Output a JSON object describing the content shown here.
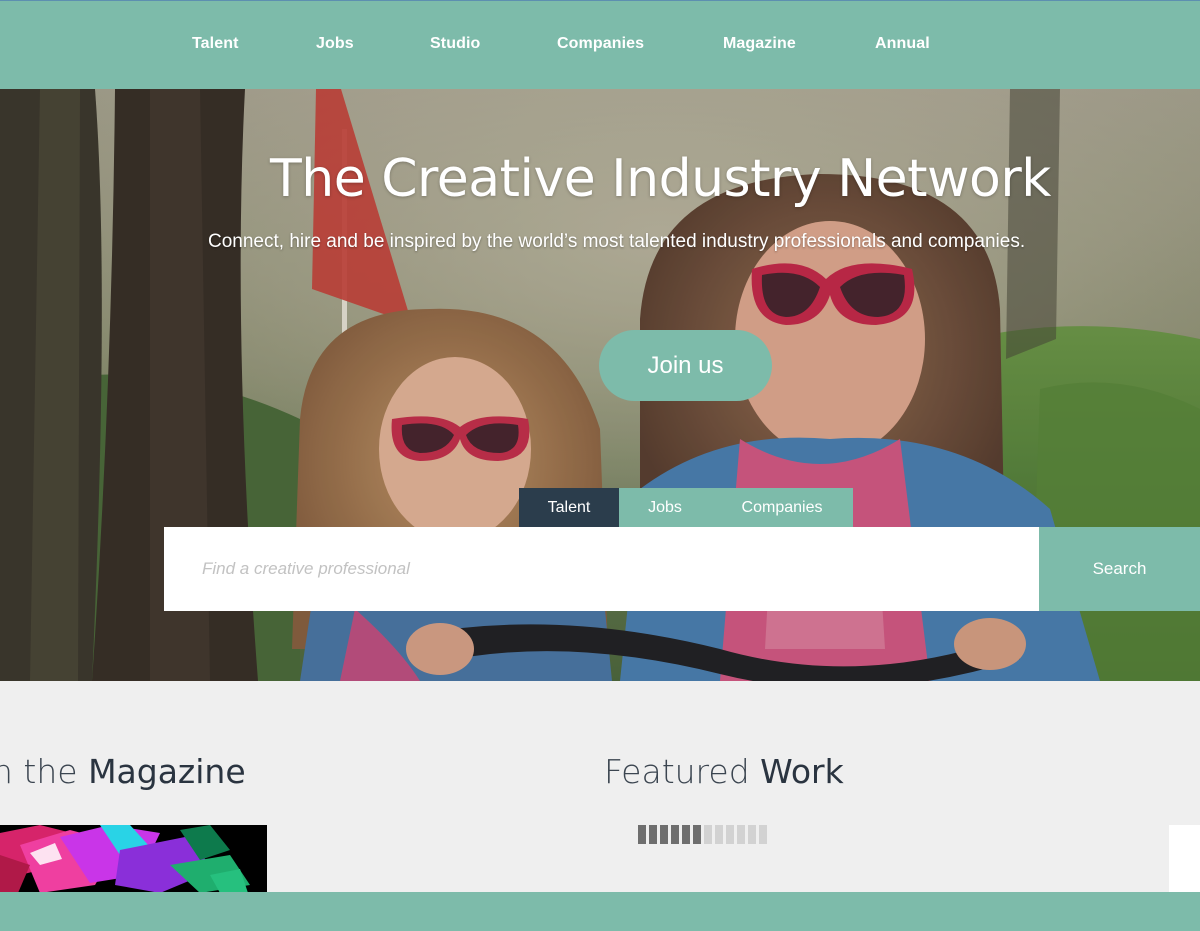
{
  "nav": {
    "items": [
      {
        "label": "Talent"
      },
      {
        "label": "Jobs"
      },
      {
        "label": "Studio"
      },
      {
        "label": "Companies"
      },
      {
        "label": "Magazine"
      },
      {
        "label": "Annual"
      }
    ]
  },
  "hero": {
    "title": "The Creative Industry Network",
    "subtitle": "Connect, hire and be inspired by the world’s most talented industry professionals and companies.",
    "join_label": "Join us",
    "image_subject": "two-girls-heart-sunglasses-bikes"
  },
  "search": {
    "tabs": [
      {
        "label": "Talent",
        "active": true
      },
      {
        "label": "Jobs",
        "active": false
      },
      {
        "label": "Companies",
        "active": false
      }
    ],
    "placeholder": "Find a creative professional",
    "button_label": "Search"
  },
  "magazine": {
    "heading_prefix": "n the ",
    "heading_strong": "Magazine"
  },
  "featured": {
    "heading_prefix": "Featured ",
    "heading_strong": "Work",
    "loading_progress": 0.5
  },
  "colors": {
    "accent": "#7dbbaa",
    "tab_active": "#2b3d4c",
    "heading": "#2a3440"
  }
}
